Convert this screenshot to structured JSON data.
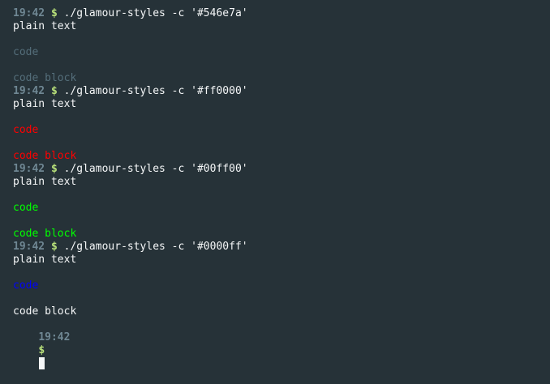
{
  "colors": {
    "background": "#263238",
    "default_text": "#f4f6f7",
    "prompt_time": "#6f8793",
    "prompt_symbol": "#b8e07a",
    "cursor": "#f4f6f7"
  },
  "blocks": [
    {
      "time": "19:42",
      "symbol": "$",
      "command": "./glamour-styles -c '#546e7a'",
      "plain": "plain text",
      "code": "code",
      "code_block": "code block",
      "code_color": "#546e7a",
      "code_block_color": "#546e7a"
    },
    {
      "time": "19:42",
      "symbol": "$",
      "command": "./glamour-styles -c '#ff0000'",
      "plain": "plain text",
      "code": "code",
      "code_block": "code block",
      "code_color": "#ff0000",
      "code_block_color": "#ff0000"
    },
    {
      "time": "19:42",
      "symbol": "$",
      "command": "./glamour-styles -c '#00ff00'",
      "plain": "plain text",
      "code": "code",
      "code_block": "code block",
      "code_color": "#00ff00",
      "code_block_color": "#00ff00"
    },
    {
      "time": "19:42",
      "symbol": "$",
      "command": "./glamour-styles -c '#0000ff'",
      "plain": "plain text",
      "code": "code",
      "code_block": "code block",
      "code_color": "#0000ff",
      "code_block_color": "#f4f6f7"
    }
  ],
  "final_prompt": {
    "time": "19:42",
    "symbol": "$"
  }
}
